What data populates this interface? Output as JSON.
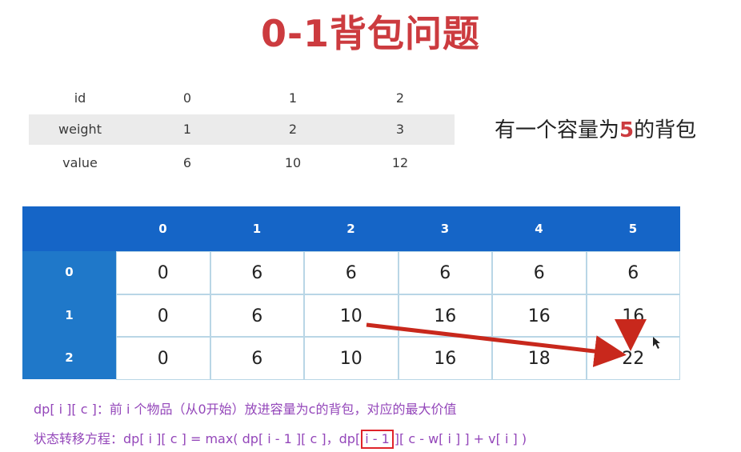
{
  "title": "0-1背包问题",
  "items_table": {
    "header": [
      "id",
      "0",
      "1",
      "2"
    ],
    "rows": [
      [
        "weight",
        "1",
        "2",
        "3"
      ],
      [
        "value",
        "6",
        "10",
        "12"
      ]
    ]
  },
  "capacity_text": {
    "prefix": "有一个容量为",
    "number": "5",
    "suffix": "的背包"
  },
  "dp_table": {
    "col_headers": [
      "0",
      "1",
      "2",
      "3",
      "4",
      "5"
    ],
    "row_headers": [
      "0",
      "1",
      "2"
    ],
    "cells": [
      [
        "0",
        "6",
        "6",
        "6",
        "6",
        "6"
      ],
      [
        "0",
        "6",
        "10",
        "16",
        "16",
        "16"
      ],
      [
        "0",
        "6",
        "10",
        "16",
        "18",
        "22"
      ]
    ]
  },
  "formulas": {
    "line1": "dp[ i ][ c ]：前 i 个物品（从0开始）放进容量为c的背包，对应的最大价值",
    "line2_pre": "状态转移方程：dp[ i ][ c ] = max( dp[ i - 1 ][ c ]，dp[",
    "line2_highlight": "i - 1",
    "line2_post": "][ c - w[ i ] ] + v[ i ] )"
  },
  "colors": {
    "title": "#cc3b3f",
    "header_blue": "#1565c7",
    "side_blue": "#1f78c9",
    "arrow_red": "#c8281c",
    "formula_purple": "#9447ba"
  }
}
